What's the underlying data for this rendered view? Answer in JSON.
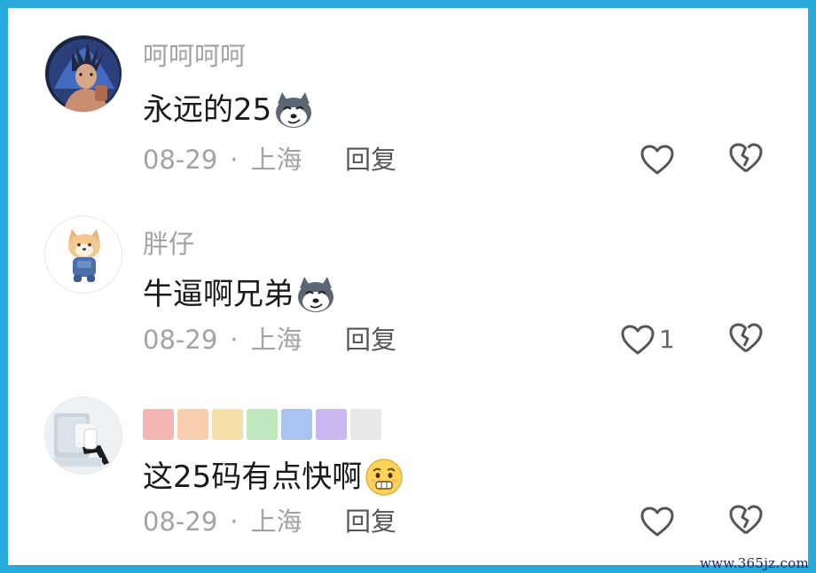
{
  "comments": [
    {
      "username": "呵呵呵呵",
      "text": "永远的25",
      "emoji": "husky-emoji",
      "date": "08-29",
      "location": "上海",
      "reply_label": "回复",
      "likes": "",
      "liked": false
    },
    {
      "username": "胖仔",
      "text": "牛逼啊兄弟",
      "emoji": "husky-emoji",
      "date": "08-29",
      "location": "上海",
      "reply_label": "回复",
      "likes": "1",
      "liked": false
    },
    {
      "username": "",
      "username_swatches": [
        "#f4b7b3",
        "#f7cfae",
        "#f7e0a8",
        "#bfe8bf",
        "#a9c4f2",
        "#c9b8ef",
        "#e8e8e8"
      ],
      "text": "这25码有点快啊",
      "emoji": "worried-face-emoji",
      "date": "08-29",
      "location": "上海",
      "reply_label": "回复",
      "likes": "",
      "liked": false
    }
  ],
  "separator": "·",
  "watermark": "www.365jz.com",
  "colors": {
    "border": "#27a9dc",
    "username": "#a3a3a3",
    "text": "#1a1a1a",
    "icon": "#555555"
  }
}
